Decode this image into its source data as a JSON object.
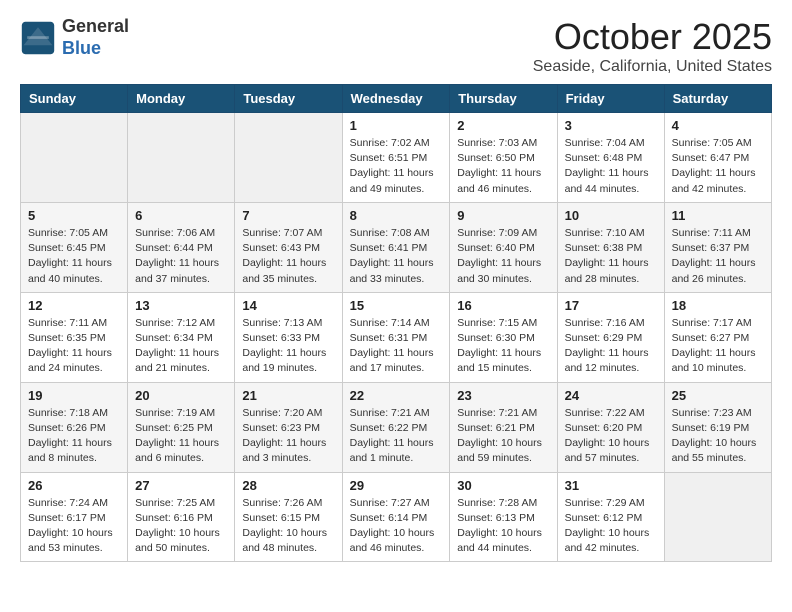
{
  "header": {
    "logo_line1": "General",
    "logo_line2": "Blue",
    "month": "October 2025",
    "location": "Seaside, California, United States"
  },
  "weekdays": [
    "Sunday",
    "Monday",
    "Tuesday",
    "Wednesday",
    "Thursday",
    "Friday",
    "Saturday"
  ],
  "weeks": [
    [
      {
        "day": "",
        "info": ""
      },
      {
        "day": "",
        "info": ""
      },
      {
        "day": "",
        "info": ""
      },
      {
        "day": "1",
        "info": "Sunrise: 7:02 AM\nSunset: 6:51 PM\nDaylight: 11 hours\nand 49 minutes."
      },
      {
        "day": "2",
        "info": "Sunrise: 7:03 AM\nSunset: 6:50 PM\nDaylight: 11 hours\nand 46 minutes."
      },
      {
        "day": "3",
        "info": "Sunrise: 7:04 AM\nSunset: 6:48 PM\nDaylight: 11 hours\nand 44 minutes."
      },
      {
        "day": "4",
        "info": "Sunrise: 7:05 AM\nSunset: 6:47 PM\nDaylight: 11 hours\nand 42 minutes."
      }
    ],
    [
      {
        "day": "5",
        "info": "Sunrise: 7:05 AM\nSunset: 6:45 PM\nDaylight: 11 hours\nand 40 minutes."
      },
      {
        "day": "6",
        "info": "Sunrise: 7:06 AM\nSunset: 6:44 PM\nDaylight: 11 hours\nand 37 minutes."
      },
      {
        "day": "7",
        "info": "Sunrise: 7:07 AM\nSunset: 6:43 PM\nDaylight: 11 hours\nand 35 minutes."
      },
      {
        "day": "8",
        "info": "Sunrise: 7:08 AM\nSunset: 6:41 PM\nDaylight: 11 hours\nand 33 minutes."
      },
      {
        "day": "9",
        "info": "Sunrise: 7:09 AM\nSunset: 6:40 PM\nDaylight: 11 hours\nand 30 minutes."
      },
      {
        "day": "10",
        "info": "Sunrise: 7:10 AM\nSunset: 6:38 PM\nDaylight: 11 hours\nand 28 minutes."
      },
      {
        "day": "11",
        "info": "Sunrise: 7:11 AM\nSunset: 6:37 PM\nDaylight: 11 hours\nand 26 minutes."
      }
    ],
    [
      {
        "day": "12",
        "info": "Sunrise: 7:11 AM\nSunset: 6:35 PM\nDaylight: 11 hours\nand 24 minutes."
      },
      {
        "day": "13",
        "info": "Sunrise: 7:12 AM\nSunset: 6:34 PM\nDaylight: 11 hours\nand 21 minutes."
      },
      {
        "day": "14",
        "info": "Sunrise: 7:13 AM\nSunset: 6:33 PM\nDaylight: 11 hours\nand 19 minutes."
      },
      {
        "day": "15",
        "info": "Sunrise: 7:14 AM\nSunset: 6:31 PM\nDaylight: 11 hours\nand 17 minutes."
      },
      {
        "day": "16",
        "info": "Sunrise: 7:15 AM\nSunset: 6:30 PM\nDaylight: 11 hours\nand 15 minutes."
      },
      {
        "day": "17",
        "info": "Sunrise: 7:16 AM\nSunset: 6:29 PM\nDaylight: 11 hours\nand 12 minutes."
      },
      {
        "day": "18",
        "info": "Sunrise: 7:17 AM\nSunset: 6:27 PM\nDaylight: 11 hours\nand 10 minutes."
      }
    ],
    [
      {
        "day": "19",
        "info": "Sunrise: 7:18 AM\nSunset: 6:26 PM\nDaylight: 11 hours\nand 8 minutes."
      },
      {
        "day": "20",
        "info": "Sunrise: 7:19 AM\nSunset: 6:25 PM\nDaylight: 11 hours\nand 6 minutes."
      },
      {
        "day": "21",
        "info": "Sunrise: 7:20 AM\nSunset: 6:23 PM\nDaylight: 11 hours\nand 3 minutes."
      },
      {
        "day": "22",
        "info": "Sunrise: 7:21 AM\nSunset: 6:22 PM\nDaylight: 11 hours\nand 1 minute."
      },
      {
        "day": "23",
        "info": "Sunrise: 7:21 AM\nSunset: 6:21 PM\nDaylight: 10 hours\nand 59 minutes."
      },
      {
        "day": "24",
        "info": "Sunrise: 7:22 AM\nSunset: 6:20 PM\nDaylight: 10 hours\nand 57 minutes."
      },
      {
        "day": "25",
        "info": "Sunrise: 7:23 AM\nSunset: 6:19 PM\nDaylight: 10 hours\nand 55 minutes."
      }
    ],
    [
      {
        "day": "26",
        "info": "Sunrise: 7:24 AM\nSunset: 6:17 PM\nDaylight: 10 hours\nand 53 minutes."
      },
      {
        "day": "27",
        "info": "Sunrise: 7:25 AM\nSunset: 6:16 PM\nDaylight: 10 hours\nand 50 minutes."
      },
      {
        "day": "28",
        "info": "Sunrise: 7:26 AM\nSunset: 6:15 PM\nDaylight: 10 hours\nand 48 minutes."
      },
      {
        "day": "29",
        "info": "Sunrise: 7:27 AM\nSunset: 6:14 PM\nDaylight: 10 hours\nand 46 minutes."
      },
      {
        "day": "30",
        "info": "Sunrise: 7:28 AM\nSunset: 6:13 PM\nDaylight: 10 hours\nand 44 minutes."
      },
      {
        "day": "31",
        "info": "Sunrise: 7:29 AM\nSunset: 6:12 PM\nDaylight: 10 hours\nand 42 minutes."
      },
      {
        "day": "",
        "info": ""
      }
    ]
  ]
}
